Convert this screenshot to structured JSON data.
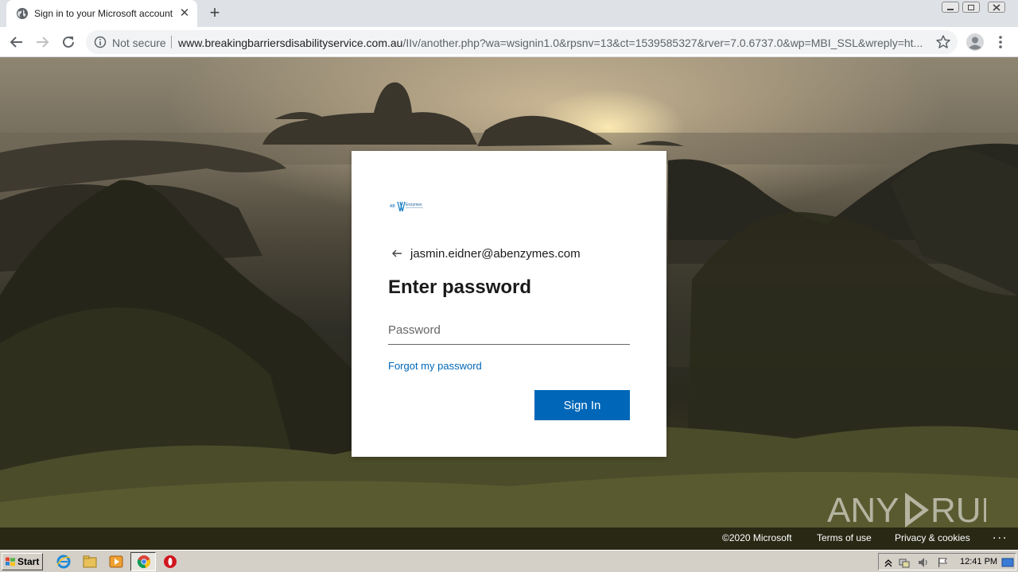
{
  "browser": {
    "tab_title": "Sign in to your Microsoft account",
    "tab_close": "✕",
    "new_tab": "+",
    "security_label": "Not secure",
    "url_host": "www.breakingbarriersdisabilityservice.com.au",
    "url_path": "/IIv/another.php?wa=wsignin1.0&rpsnv=13&ct=1539585327&rver=7.0.6737.0&wp=MBI_SSL&wreply=ht..."
  },
  "signin": {
    "logo_text": "AB Enzymes",
    "email": "jasmin.eidner@abenzymes.com",
    "heading": "Enter password",
    "password_placeholder": "Password",
    "forgot_link": "Forgot my password",
    "submit_label": "Sign In"
  },
  "footer": {
    "copyright": "©2020 Microsoft",
    "terms": "Terms of use",
    "privacy": "Privacy & cookies",
    "more": "..."
  },
  "watermark": {
    "text_left": "ANY",
    "text_right": "RUN"
  },
  "taskbar": {
    "start_label": "Start",
    "clock": "12:41 PM"
  },
  "colors": {
    "accent": "#0067b8",
    "card_bg": "#ffffff",
    "taskbar_bg": "#d4d0c8"
  }
}
